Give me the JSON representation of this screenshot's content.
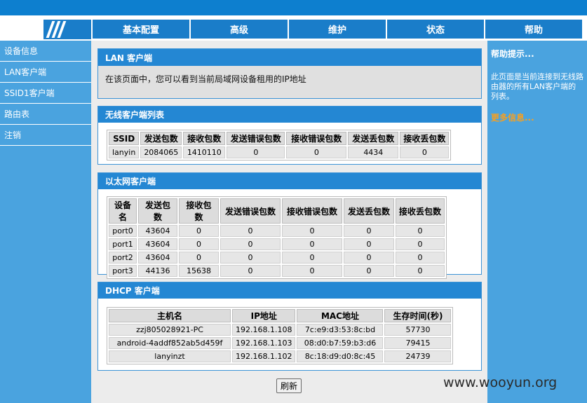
{
  "nav": [
    "基本配置",
    "高级",
    "维护",
    "状态",
    "帮助"
  ],
  "sidebar": [
    "设备信息",
    "LAN客户端",
    "SSID1客户端",
    "路由表",
    "注销"
  ],
  "intro": {
    "title": "LAN 客户端",
    "text": "在该页面中，您可以看到当前局域网设备租用的IP地址"
  },
  "wireless": {
    "title": "无线客户端列表",
    "headers": [
      "SSID",
      "发送包数",
      "接收包数",
      "发送错误包数",
      "接收错误包数",
      "发送丢包数",
      "接收丢包数"
    ],
    "rows": [
      [
        "lanyin",
        "2084065",
        "1410110",
        "0",
        "0",
        "4434",
        "0"
      ]
    ]
  },
  "ethernet": {
    "title": "以太网客户端",
    "headers": [
      "设备名",
      "发送包数",
      "接收包数",
      "发送错误包数",
      "接收错误包数",
      "发送丢包数",
      "接收丢包数"
    ],
    "rows": [
      [
        "port0",
        "43604",
        "0",
        "0",
        "0",
        "0",
        "0"
      ],
      [
        "port1",
        "43604",
        "0",
        "0",
        "0",
        "0",
        "0"
      ],
      [
        "port2",
        "43604",
        "0",
        "0",
        "0",
        "0",
        "0"
      ],
      [
        "port3",
        "44136",
        "15638",
        "0",
        "0",
        "0",
        "0"
      ]
    ]
  },
  "dhcp": {
    "title": "DHCP 客户端",
    "headers": [
      "主机名",
      "IP地址",
      "MAC地址",
      "生存时间(秒)"
    ],
    "rows": [
      [
        "zzj805028921-PC",
        "192.168.1.108",
        "7c:e9:d3:53:8c:bd",
        "57730"
      ],
      [
        "android-4addf852ab5d459f",
        "192.168.1.103",
        "08:d0:b7:59:b3:d6",
        "79415"
      ],
      [
        "lanyinzt",
        "192.168.1.102",
        "8c:18:d9:d0:8c:45",
        "24739"
      ]
    ]
  },
  "help": {
    "title": "帮助提示...",
    "text": "此页面是当前连接到无线路由器的所有LAN客户端的列表。",
    "more": "更多信息..."
  },
  "refresh_label": "刷新",
  "watermark": "www.wooyun.org"
}
